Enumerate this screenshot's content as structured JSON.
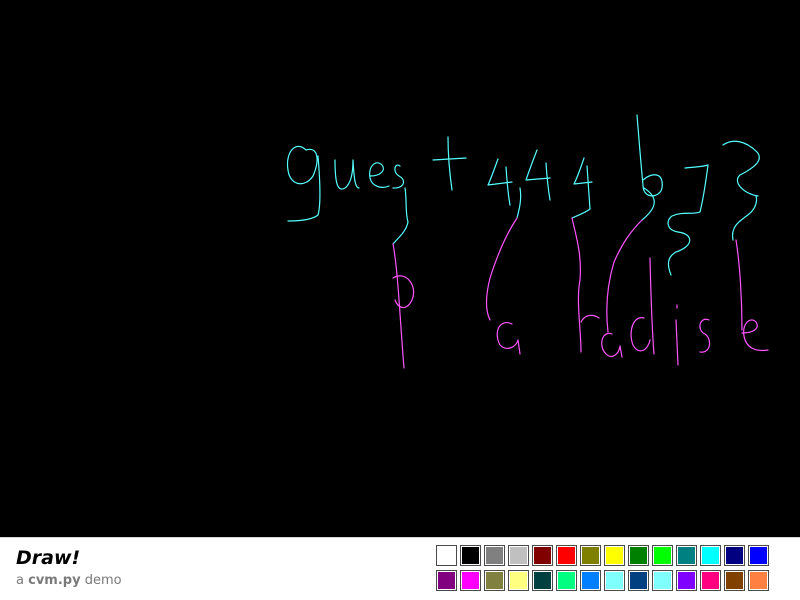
{
  "app": {
    "title": "Draw!",
    "subtitle_prefix": "a",
    "subtitle_name": "cvm.py",
    "subtitle_suffix": "demo"
  },
  "canvas": {
    "background": "#000000",
    "stroke_colors": [
      "#55ffff",
      "#ff55ff"
    ]
  },
  "palette": [
    "#ffffff",
    "#000000",
    "#808080",
    "#c0c0c0",
    "#800000",
    "#ff0000",
    "#808000",
    "#ffff00",
    "#008000",
    "#00ff00",
    "#008080",
    "#00ffff",
    "#000080",
    "#0000ff",
    "#800080",
    "#ff00ff",
    "#808040",
    "#ffff80",
    "#004040",
    "#00ff80",
    "#0080ff",
    "#80ffff",
    "#004080",
    "#80ffff",
    "#8000ff",
    "#ff0080",
    "#804000",
    "#ff8040"
  ]
}
